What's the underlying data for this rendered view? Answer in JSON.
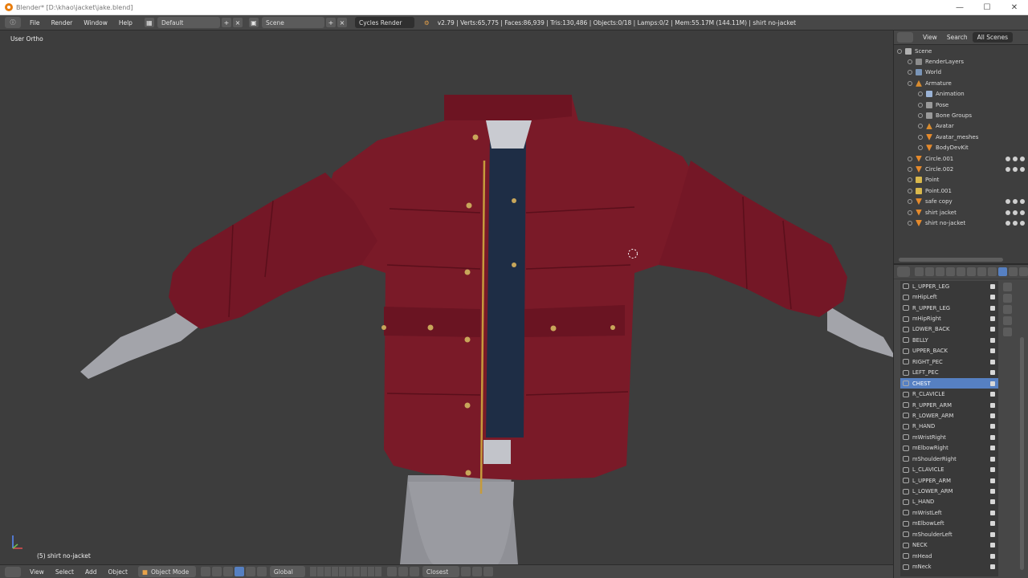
{
  "window": {
    "title": "Blender* [D:\\khao\\jacket\\jake.blend]",
    "controls": [
      "—",
      "☐",
      "✕"
    ]
  },
  "info_header": {
    "menus": [
      "File",
      "Render",
      "Window",
      "Help"
    ],
    "screen_layout": "Default",
    "scene": "Scene",
    "render_engine": "Cycles Render",
    "stats": "v2.79 | Verts:65,775 | Faces:86,939 | Tris:130,486 | Objects:0/18 | Lamps:0/2 | Mem:55.17M (144.11M) | shirt no-jacket"
  },
  "viewport": {
    "view_label": "User Ortho",
    "object_label": "(5) shirt no-jacket"
  },
  "viewport_header": {
    "menus": [
      "View",
      "Select",
      "Add",
      "Object"
    ],
    "mode": "Object Mode",
    "orientation": "Global",
    "snap": "Closest"
  },
  "outliner": {
    "tabs": [
      "View",
      "Search",
      "All Scenes"
    ],
    "rows": [
      {
        "label": "Scene",
        "icon": "scene-icon",
        "indent": 0
      },
      {
        "label": "RenderLayers",
        "icon": "renderlayers-icon",
        "indent": 1
      },
      {
        "label": "World",
        "icon": "world-icon",
        "indent": 1
      },
      {
        "label": "Armature",
        "icon": "armature-icon",
        "indent": 1
      },
      {
        "label": "Animation",
        "icon": "animation-icon",
        "indent": 2
      },
      {
        "label": "Pose",
        "icon": "pose-icon",
        "indent": 2
      },
      {
        "label": "Bone Groups",
        "icon": "bone-groups-icon",
        "indent": 2
      },
      {
        "label": "Avatar",
        "icon": "armature-data-icon",
        "indent": 2
      },
      {
        "label": "Avatar_meshes",
        "icon": "mesh-icon",
        "indent": 2
      },
      {
        "label": "BodyDevKit",
        "icon": "mesh-icon",
        "indent": 2
      },
      {
        "label": "Circle.001",
        "icon": "mesh-icon",
        "indent": 1
      },
      {
        "label": "Circle.002",
        "icon": "mesh-icon",
        "indent": 1
      },
      {
        "label": "Point",
        "icon": "lamp-icon",
        "indent": 1
      },
      {
        "label": "Point.001",
        "icon": "lamp-icon",
        "indent": 1
      },
      {
        "label": "safe copy",
        "icon": "mesh-icon",
        "indent": 1
      },
      {
        "label": "shirt jacket",
        "icon": "mesh-icon",
        "indent": 1
      },
      {
        "label": "shirt no-jacket",
        "icon": "mesh-icon",
        "indent": 1
      }
    ]
  },
  "vertex_groups": {
    "items": [
      "L_UPPER_LEG",
      "mHipLeft",
      "R_UPPER_LEG",
      "mHipRight",
      "LOWER_BACK",
      "BELLY",
      "UPPER_BACK",
      "RIGHT_PEC",
      "LEFT_PEC",
      "CHEST",
      "R_CLAVICLE",
      "R_UPPER_ARM",
      "R_LOWER_ARM",
      "R_HAND",
      "mWristRight",
      "mElbowRight",
      "mShoulderRight",
      "L_CLAVICLE",
      "L_UPPER_ARM",
      "L_LOWER_ARM",
      "L_HAND",
      "mWristLeft",
      "mElbowLeft",
      "mShoulderLeft",
      "NECK",
      "mHead",
      "mNeck"
    ],
    "active": "CHEST"
  },
  "colors": {
    "jacket": "#7a1a28",
    "accent_blue": "#5680c2",
    "viewport_bg": "#3d3d3d"
  }
}
